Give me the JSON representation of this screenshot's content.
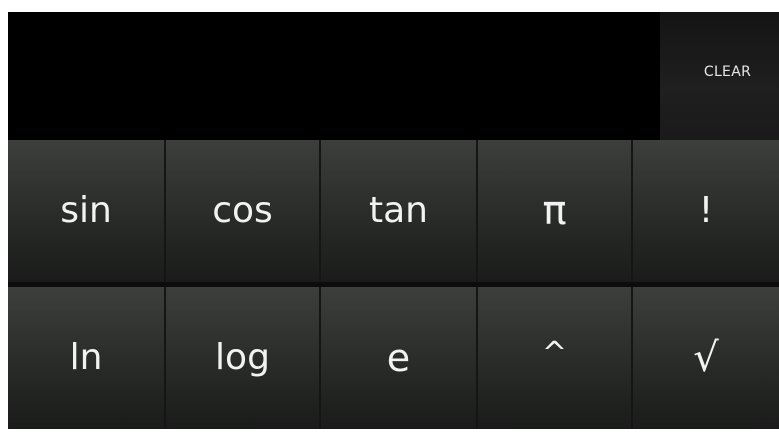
{
  "display": {
    "clear_label": "CLEAR"
  },
  "keypad": {
    "row1": [
      "sin",
      "cos",
      "tan",
      "π",
      "!"
    ],
    "row2": [
      "ln",
      "log",
      "e",
      "^",
      "√"
    ]
  },
  "colors": {
    "background": "#000000",
    "key_top": "#3d3f3d",
    "key_bottom": "#1a1b1a",
    "label": "#f2f2f2"
  }
}
